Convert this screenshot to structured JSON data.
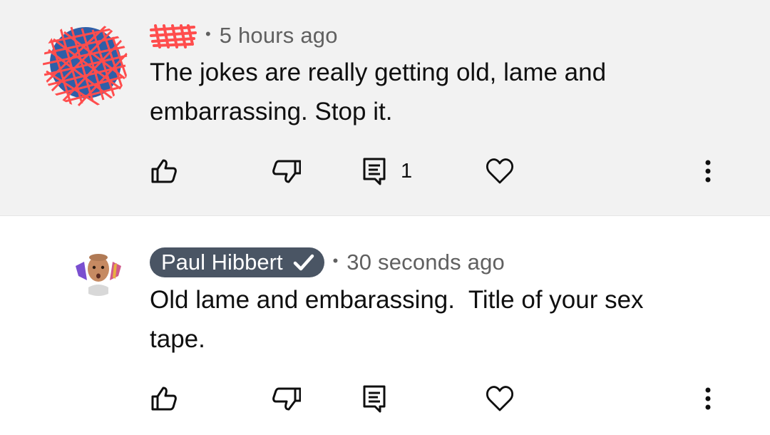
{
  "comments": [
    {
      "author_redacted": true,
      "timestamp": "5 hours ago",
      "text": "The jokes are really getting old, lame and embarrassing. Stop it.",
      "reply_count": "1",
      "avatar_color": "#2e5fa8",
      "redaction_color": "#ff4d4d"
    },
    {
      "author": "Paul Hibbert",
      "verified": true,
      "timestamp": "30 seconds ago",
      "text": "Old lame and embarassing.  Title of your sex tape.",
      "reply_count": "",
      "author_pill_color": "#4a5564"
    }
  ],
  "icons": {
    "like": "thumbs-up-icon",
    "dislike": "thumbs-down-icon",
    "reply": "comment-reply-icon",
    "heart": "heart-icon",
    "more": "more-vertical-icon",
    "verified": "checkmark-icon"
  },
  "separator": "•"
}
